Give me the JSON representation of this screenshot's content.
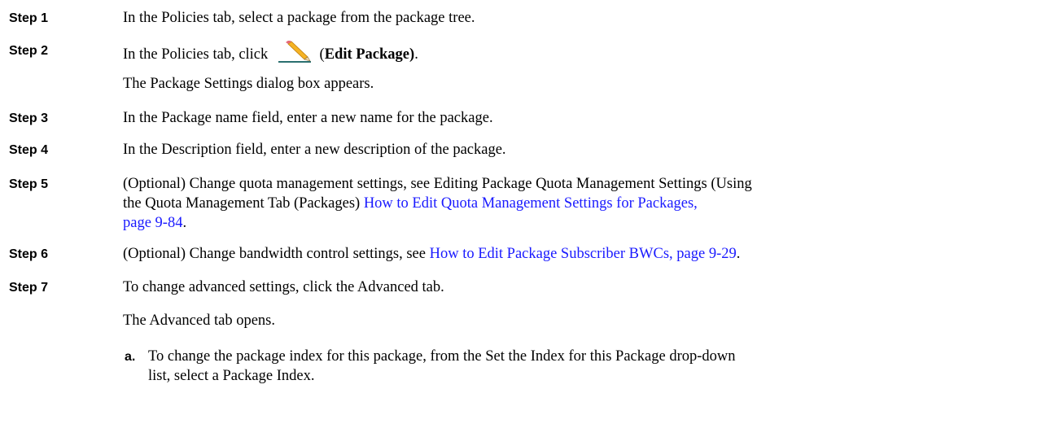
{
  "steps": [
    {
      "label": "Step 1",
      "text": "In the Policies tab, select a package from the package tree."
    },
    {
      "label": "Step 2",
      "text_before": "In the Policies tab, click",
      "icon": "edit-pencil-icon",
      "paren_open": "(",
      "bold": "Edit Package)",
      "text_after": ".",
      "result": "The Package Settings dialog box appears."
    },
    {
      "label": "Step 3",
      "text": "In the Package name field, enter a new name for the package."
    },
    {
      "label": "Step 4",
      "text": "In the Description field, enter a new description of the package."
    },
    {
      "label": "Step 5",
      "line1": "(Optional) Change quota management settings, see Editing Package Quota Management Settings (Using",
      "line2_text": "the Quota Management Tab (Packages)",
      "line2_link": "How to Edit Quota Management Settings for Packages,",
      "line3_link": "page 9-84",
      "line3_after": "."
    },
    {
      "label": "Step 6",
      "text": "(Optional) Change bandwidth control settings, see",
      "link": "How to Edit Package Subscriber BWCs, page 9-29",
      "after": "."
    },
    {
      "label": "Step 7",
      "text": "To change advanced settings, click the Advanced tab.",
      "result": "The Advanced tab opens."
    }
  ],
  "substeps": [
    {
      "label": "a.",
      "line1": "To change the package index for this package, from the Set the Index for this Package drop-down",
      "line2": "list, select a Package Index."
    }
  ],
  "colors": {
    "link": "#1a1aff",
    "text": "#000000"
  }
}
